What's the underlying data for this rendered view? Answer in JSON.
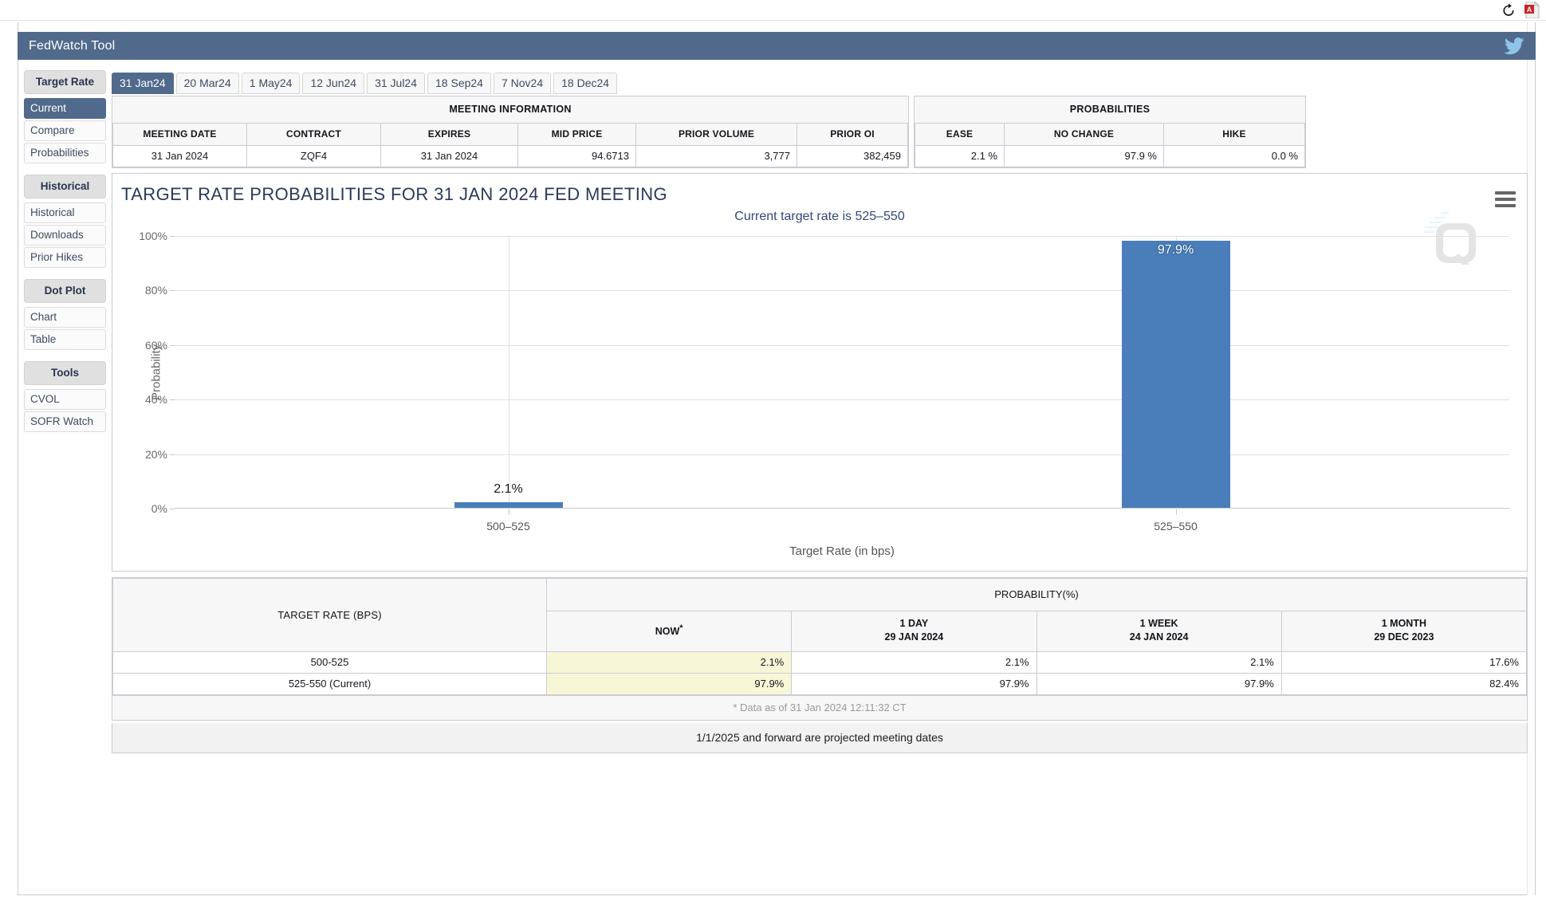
{
  "browser_bar": {
    "refresh_icon": "refresh-icon",
    "pdf_icon": "pdf-icon"
  },
  "titlebar": {
    "title": "FedWatch Tool",
    "social_icon": "twitter-icon"
  },
  "sidebar": {
    "groups": [
      {
        "header": "Target Rate",
        "items": [
          {
            "label": "Current",
            "active": true
          },
          {
            "label": "Compare",
            "active": false
          },
          {
            "label": "Probabilities",
            "active": false
          }
        ]
      },
      {
        "header": "Historical",
        "items": [
          {
            "label": "Historical",
            "active": false
          },
          {
            "label": "Downloads",
            "active": false
          },
          {
            "label": "Prior Hikes",
            "active": false
          }
        ]
      },
      {
        "header": "Dot Plot",
        "items": [
          {
            "label": "Chart",
            "active": false
          },
          {
            "label": "Table",
            "active": false
          }
        ]
      },
      {
        "header": "Tools",
        "items": [
          {
            "label": "CVOL",
            "active": false
          },
          {
            "label": "SOFR Watch",
            "active": false
          }
        ]
      }
    ]
  },
  "tabs": [
    {
      "label": "31 Jan24",
      "active": true
    },
    {
      "label": "20 Mar24",
      "active": false
    },
    {
      "label": "1 May24",
      "active": false
    },
    {
      "label": "12 Jun24",
      "active": false
    },
    {
      "label": "31 Jul24",
      "active": false
    },
    {
      "label": "18 Sep24",
      "active": false
    },
    {
      "label": "7 Nov24",
      "active": false
    },
    {
      "label": "18 Dec24",
      "active": false
    }
  ],
  "meeting_information": {
    "title": "MEETING INFORMATION",
    "headers": [
      "MEETING DATE",
      "CONTRACT",
      "EXPIRES",
      "MID PRICE",
      "PRIOR VOLUME",
      "PRIOR OI"
    ],
    "row": [
      "31 Jan 2024",
      "ZQF4",
      "31 Jan 2024",
      "94.6713",
      "3,777",
      "382,459"
    ]
  },
  "probabilities_panel": {
    "title": "PROBABILITIES",
    "headers": [
      "EASE",
      "NO CHANGE",
      "HIKE"
    ],
    "row": [
      "2.1 %",
      "97.9 %",
      "0.0 %"
    ]
  },
  "chart_data": {
    "type": "bar",
    "title": "TARGET RATE PROBABILITIES FOR 31 JAN 2024 FED MEETING",
    "subtitle": "Current target rate is 525–550",
    "categories": [
      "500–525",
      "525–550"
    ],
    "values": [
      2.1,
      97.9
    ],
    "value_labels": [
      "2.1%",
      "97.9%"
    ],
    "xlabel": "Target Rate (in bps)",
    "ylabel": "Probability",
    "ylim": [
      0,
      100
    ],
    "yticks": [
      0,
      20,
      40,
      60,
      80,
      100
    ],
    "ytick_labels": [
      "0%",
      "20%",
      "40%",
      "60%",
      "80%",
      "100%"
    ],
    "grid": true,
    "legend": "none",
    "bar_color": "#4a7ebb",
    "menu_icon": "hamburger-menu-icon",
    "watermark": "cme-q-watermark"
  },
  "bottom_table": {
    "target_rate_header": "TARGET RATE (BPS)",
    "probability_header": "PROBABILITY(%)",
    "columns": [
      {
        "title": "NOW",
        "star": "*",
        "date": ""
      },
      {
        "title": "1 DAY",
        "star": "",
        "date": "29 JAN 2024"
      },
      {
        "title": "1 WEEK",
        "star": "",
        "date": "24 JAN 2024"
      },
      {
        "title": "1 MONTH",
        "star": "",
        "date": "29 DEC 2023"
      }
    ],
    "rows": [
      {
        "target": "500-525",
        "now": "2.1%",
        "day": "2.1%",
        "week": "2.1%",
        "month": "17.6%"
      },
      {
        "target": "525-550 (Current)",
        "now": "97.9%",
        "day": "97.9%",
        "week": "97.9%",
        "month": "82.4%"
      }
    ],
    "footnote": "* Data as of 31 Jan 2024 12:11:32 CT",
    "projection_note": "1/1/2025 and forward are projected meeting dates"
  },
  "colors": {
    "brand_blue": "#516a8b",
    "bar_blue": "#4a7ebb",
    "highlight_yellow": "#f7f7d8"
  }
}
